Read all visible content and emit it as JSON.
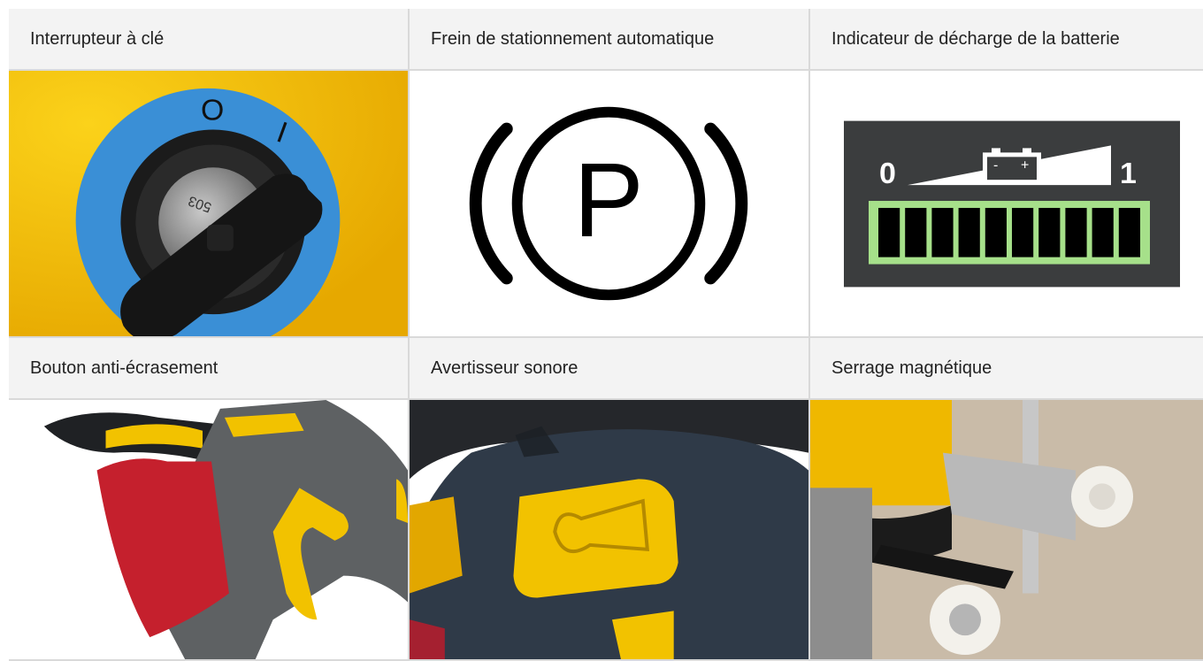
{
  "row1": {
    "labels": [
      "Interrupteur à clé",
      "Frein de stationnement automatique",
      "Indicateur de décharge de la batterie"
    ]
  },
  "row2": {
    "icons": [
      "key-switch-image",
      "parking-brake-icon",
      "battery-discharge-indicator-image"
    ]
  },
  "row3": {
    "labels": [
      "Bouton anti-écrasement",
      "Avertisseur sonore",
      "Serrage magnétique"
    ]
  },
  "row4": {
    "icons": [
      "anti-crush-button-image",
      "horn-button-image",
      "magnetic-clamp-image"
    ]
  },
  "key_switch": {
    "off_mark": "O",
    "on_mark": "I",
    "key_text": "503"
  },
  "parking_brake": {
    "symbol": "P"
  },
  "battery": {
    "min_label": "0",
    "max_label": "1",
    "minus": "-",
    "plus": "+",
    "segments_lit": 10,
    "segments_total": 10
  },
  "colors": {
    "label_bg": "#f3f3f3",
    "grid_line": "#d9d9d9",
    "yellow": "#f5c400",
    "blue": "#3a8fd6",
    "battery_green": "#a6e08a",
    "panel_dark": "#3b3d3e"
  }
}
